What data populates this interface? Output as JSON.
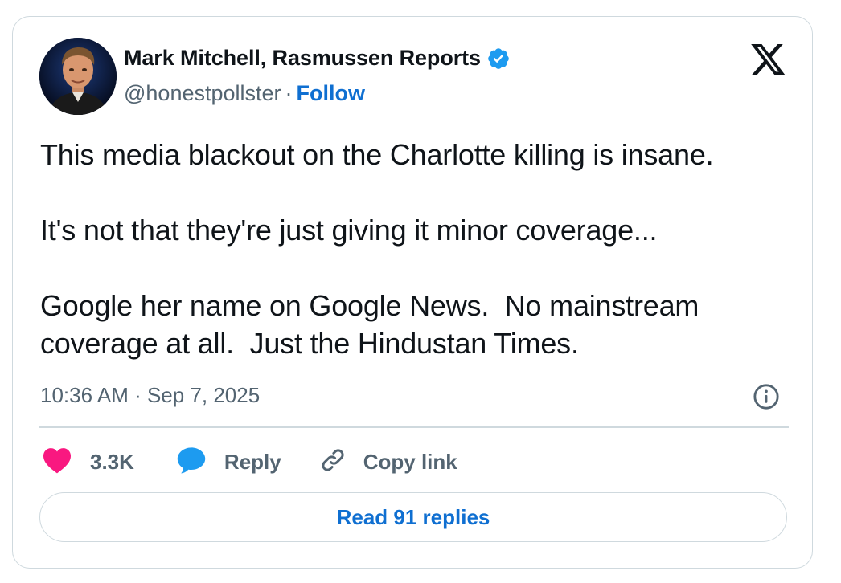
{
  "author": {
    "display_name": "Mark Mitchell, Rasmussen Reports",
    "handle": "@honestpollster",
    "separator": "·",
    "follow_label": "Follow",
    "verified": true
  },
  "tweet": {
    "text": "This media blackout on the Charlotte killing is insane.\n\nIt's not that they're just giving it minor coverage...\n\nGoogle her name on Google News.  No mainstream coverage at all.  Just the Hindustan Times.",
    "timestamp": "10:36 AM · Sep 7, 2025"
  },
  "actions": {
    "like_count": "3.3K",
    "reply_label": "Reply",
    "copy_link_label": "Copy link"
  },
  "read_replies_label": "Read 91 replies",
  "icons": {
    "logo": "x-logo-icon",
    "verified": "verified-badge-icon",
    "info": "info-icon",
    "like": "heart-icon",
    "reply": "speech-bubble-icon",
    "copy": "link-icon"
  },
  "colors": {
    "accent": "#0f6fd1",
    "like": "#f91880",
    "reply": "#1d9bf0",
    "secondary_text": "#536471",
    "border": "#cfd9de"
  }
}
